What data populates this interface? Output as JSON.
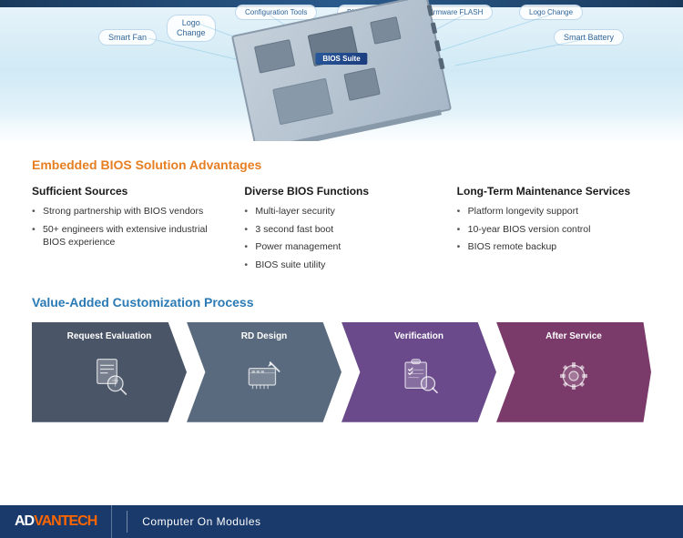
{
  "diagram": {
    "bubbles": [
      {
        "label": "Smart Fan",
        "class": "bubble-smart-fan"
      },
      {
        "label": "Logo\nChange",
        "class": "bubble-logo-change-left"
      },
      {
        "label": "Configuration Tools",
        "class": "bubble-config-tools"
      },
      {
        "label": "Firmware FLASH",
        "class": "bubble-firmware-flash"
      },
      {
        "label": "Logo Change",
        "class": "bubble-logo-change-right"
      },
      {
        "label": "Smart Battery",
        "class": "bubble-smart-battery"
      },
      {
        "label": "BIOS Editor",
        "class": "bubble-bios-editor"
      }
    ],
    "bios_suite": "BIOS Suite"
  },
  "advantages": {
    "section_title": "Embedded BIOS Solution Advantages",
    "columns": [
      {
        "title": "Sufficient Sources",
        "items": [
          "Strong partnership with BIOS vendors",
          "50+ engineers with extensive industrial BIOS experience"
        ]
      },
      {
        "title": "Diverse BIOS Functions",
        "items": [
          "Multi-layer security",
          "3 second fast boot",
          "Power management",
          "BIOS suite utility"
        ]
      },
      {
        "title": "Long-Term Maintenance Services",
        "items": [
          "Platform longevity support",
          "10-year BIOS version control",
          "BIOS remote backup"
        ]
      }
    ]
  },
  "process": {
    "section_title": "Value-Added Customization Process",
    "steps": [
      {
        "label": "Request Evaluation",
        "icon": "📋"
      },
      {
        "label": "RD Design",
        "icon": "🔧"
      },
      {
        "label": "Verification",
        "icon": "✅"
      },
      {
        "label": "After Service",
        "icon": "⚙️"
      }
    ]
  },
  "footer": {
    "logo_ad": "AD",
    "logo_vantec": "VANTECH",
    "product_line": "Computer On Modules"
  }
}
